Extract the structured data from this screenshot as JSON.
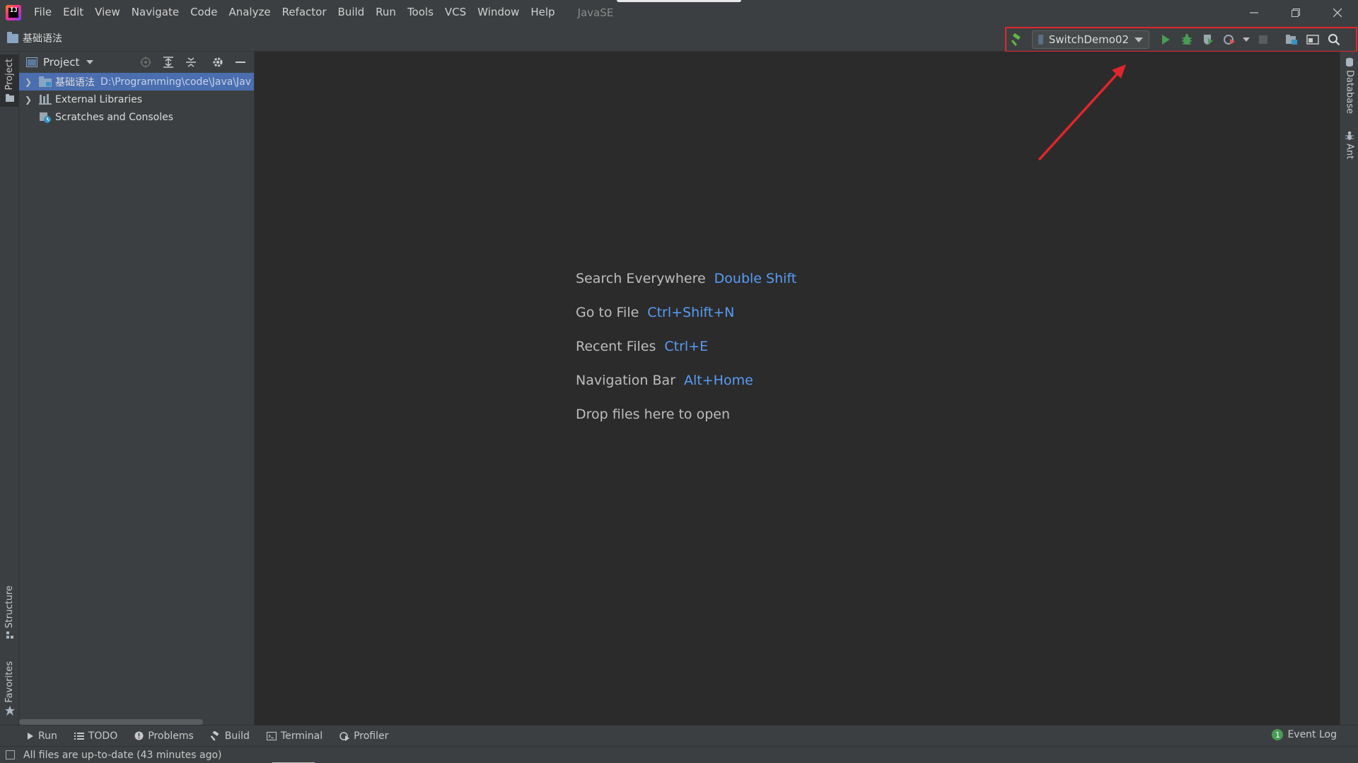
{
  "app": {
    "logo_letters": "IJ",
    "project_title": "JavaSE"
  },
  "menu": [
    "File",
    "Edit",
    "View",
    "Navigate",
    "Code",
    "Analyze",
    "Refactor",
    "Build",
    "Run",
    "Tools",
    "VCS",
    "Window",
    "Help"
  ],
  "window_controls": [
    "minimize-icon",
    "restore-icon",
    "close-icon"
  ],
  "navbar": {
    "breadcrumb": "基础语法"
  },
  "toolbar": {
    "run_config": "SwitchDemo02",
    "icons": [
      "build-hammer-icon",
      "run-config-dropdown",
      "run-icon",
      "debug-icon",
      "coverage-icon",
      "profile-icon",
      "stop-icon",
      "project-structure-icon",
      "toggle-panel-icon",
      "search-icon"
    ]
  },
  "left_strip": {
    "project": "Project",
    "structure": "Structure",
    "favorites": "Favorites"
  },
  "project_panel": {
    "title": "Project",
    "tree": [
      {
        "label": "基础语法",
        "path": "D:\\Programming\\code\\Java\\Jav",
        "selected": true,
        "expandable": true,
        "icon": "module-folder-icon"
      },
      {
        "label": "External Libraries",
        "path": "",
        "selected": false,
        "expandable": true,
        "icon": "libraries-icon"
      },
      {
        "label": "Scratches and Consoles",
        "path": "",
        "selected": false,
        "expandable": false,
        "icon": "scratches-icon"
      }
    ]
  },
  "editor": {
    "hints": [
      {
        "text": "Search Everywhere",
        "key": "Double Shift"
      },
      {
        "text": "Go to File",
        "key": "Ctrl+Shift+N"
      },
      {
        "text": "Recent Files",
        "key": "Ctrl+E"
      },
      {
        "text": "Navigation Bar",
        "key": "Alt+Home"
      },
      {
        "text": "Drop files here to open",
        "key": ""
      }
    ]
  },
  "right_strip": {
    "database": "Database",
    "ant": "Ant"
  },
  "bottom_tabs": [
    {
      "label": "Run",
      "icon": "run-icon"
    },
    {
      "label": "TODO",
      "icon": "todo-list-icon"
    },
    {
      "label": "Problems",
      "icon": "problems-icon"
    },
    {
      "label": "Build",
      "icon": "build-hammer-icon"
    },
    {
      "label": "Terminal",
      "icon": "terminal-icon"
    },
    {
      "label": "Profiler",
      "icon": "profiler-icon"
    }
  ],
  "event_log": {
    "count": "1",
    "label": "Event Log"
  },
  "status": {
    "text": "All files are up-to-date (43 minutes ago)"
  },
  "colors": {
    "accent_blue": "#589df6",
    "selection": "#4b6eaf",
    "annotation_red": "#e0262c",
    "run_green": "#499c54"
  }
}
